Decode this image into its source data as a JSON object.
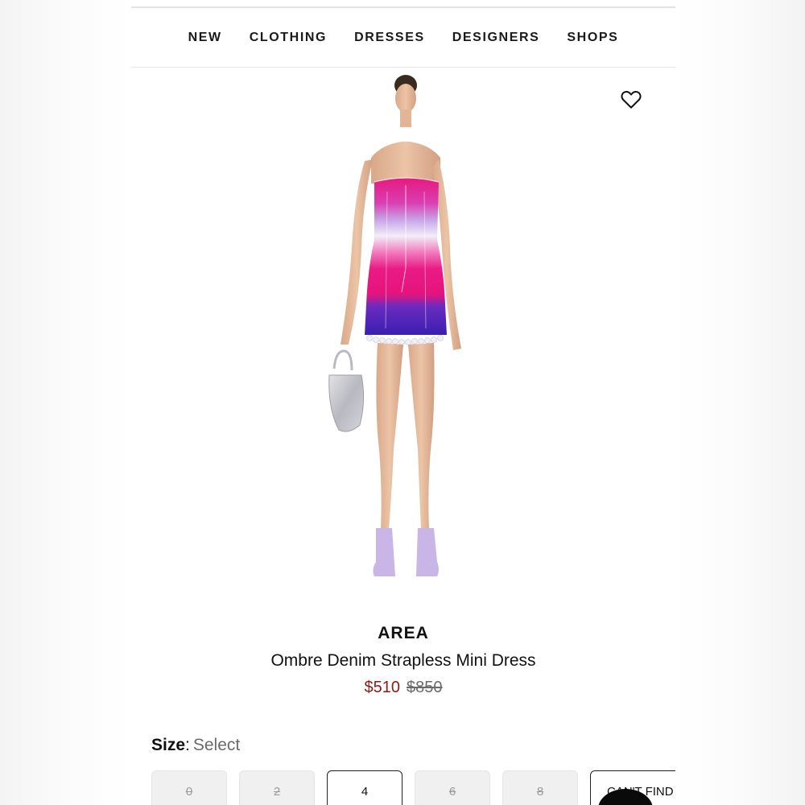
{
  "nav": {
    "items": [
      "NEW",
      "CLOTHING",
      "DRESSES",
      "DESIGNERS",
      "SHOPS"
    ]
  },
  "icons": {
    "wishlist": "heart-icon",
    "chat": "chat-bubble-icon"
  },
  "product": {
    "brand": "AREA",
    "name": "Ombre Denim Strapless Mini Dress",
    "sale_price": "$510",
    "original_price": "$850"
  },
  "size": {
    "label": "Size",
    "colon": ":",
    "value": "Select",
    "options": [
      {
        "label": "0",
        "available": false
      },
      {
        "label": "2",
        "available": false
      },
      {
        "label": "4",
        "available": true
      },
      {
        "label": "6",
        "available": false
      },
      {
        "label": "8",
        "available": false
      }
    ],
    "cant_find": "CAN'T FIND"
  },
  "colors": {
    "sale_price": "#8b1a1a",
    "dress_pink": "#e8197f",
    "dress_purple": "#3a1fb0",
    "dress_lilac": "#c9a6e8"
  }
}
